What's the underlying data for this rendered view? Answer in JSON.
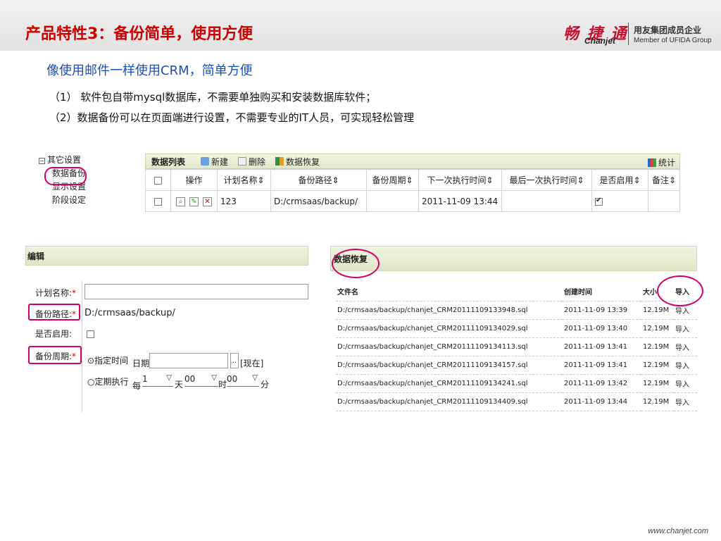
{
  "header": {
    "title": "产品特性3：备份简单，使用方便",
    "logo_cn": "畅 捷 通",
    "logo_en": "Chanjet",
    "logo_text_1": "用友集团成员企业",
    "logo_text_2": "Member of UFIDA Group"
  },
  "subtitle": "像使用邮件一样使用CRM，简单方便",
  "points": [
    "（1） 软件包自带mysql数据库，不需要单独购买和安装数据库软件；",
    "（2）数据备份可以在页面端进行设置，不需要专业的IT人员，可实现轻松管理"
  ],
  "tree": {
    "root": "其它设置",
    "items": [
      "数据备份",
      "显示设置",
      "阶段设定"
    ]
  },
  "grid": {
    "toolbar_title": "数据列表",
    "btn_new": "新建",
    "btn_delete": "删除",
    "btn_restore": "数据恢复",
    "btn_stats": "统计",
    "columns": [
      "操作",
      "计划名称",
      "备份路径",
      "备份周期",
      "下一次执行时间",
      "最后一次执行时间",
      "是否启用",
      "备注"
    ],
    "row": {
      "name": "123",
      "path": "D:/crmsaas/backup/",
      "period": "",
      "next_time": "2011-11-09 13:44",
      "last_time": "",
      "enabled": true,
      "note": ""
    }
  },
  "edit": {
    "title": "编辑",
    "label_plan": "计划名称:",
    "label_path": "备份路径:",
    "label_enabled": "是否启用:",
    "label_period": "备份周期:",
    "path_value": "D:/crmsaas/backup/",
    "opt_time": "⊙指定时间",
    "opt_rule": "○定期执行",
    "date_label": "日期",
    "now_label": "[现在]",
    "per_label": "每",
    "sel_day_value": "1",
    "unit_day": "天",
    "sel_hour_value": "00",
    "unit_hour": "时",
    "sel_min_value": "00",
    "unit_min": "分"
  },
  "restore": {
    "title": "数据恢复",
    "headers": [
      "文件名",
      "创建时间",
      "大小",
      "导入"
    ],
    "rows": [
      {
        "file": "D:/crmsaas/backup/chanjet_CRM20111109133948.sql",
        "time": "2011-11-09 13:39",
        "size": "12.19M",
        "action": "导入"
      },
      {
        "file": "D:/crmsaas/backup/chanjet_CRM20111109134029.sql",
        "time": "2011-11-09 13:40",
        "size": "12.19M",
        "action": "导入"
      },
      {
        "file": "D:/crmsaas/backup/chanjet_CRM20111109134113.sql",
        "time": "2011-11-09 13:41",
        "size": "12.19M",
        "action": "导入"
      },
      {
        "file": "D:/crmsaas/backup/chanjet_CRM20111109134157.sql",
        "time": "2011-11-09 13:41",
        "size": "12.19M",
        "action": "导入"
      },
      {
        "file": "D:/crmsaas/backup/chanjet_CRM20111109134241.sql",
        "time": "2011-11-09 13:42",
        "size": "12.19M",
        "action": "导入"
      },
      {
        "file": "D:/crmsaas/backup/chanjet_CRM20111109134409.sql",
        "time": "2011-11-09 13:44",
        "size": "12.19M",
        "action": "导入"
      }
    ]
  },
  "footer_url": "www.chanjet.com",
  "colors": {
    "title_red": "#cc0000",
    "subtitle_blue": "#1a4fb5",
    "highlight": "#d4006a"
  }
}
